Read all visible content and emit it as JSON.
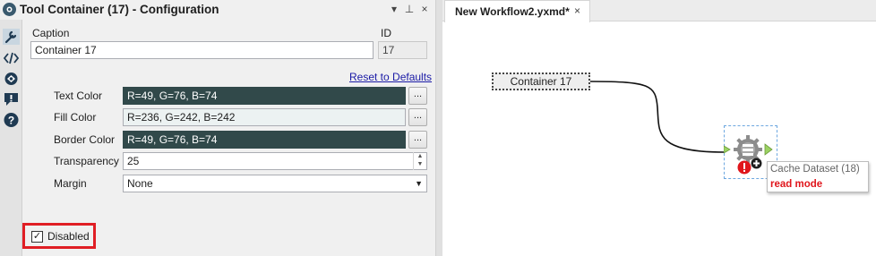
{
  "config_panel": {
    "title": "Tool Container (17) - Configuration",
    "caption_label": "Caption",
    "caption_value": "Container 17",
    "id_label": "ID",
    "id_value": "17",
    "reset_link": "Reset to Defaults",
    "text_color_label": "Text Color",
    "text_color_value": "R=49, G=76, B=74",
    "fill_color_label": "Fill Color",
    "fill_color_value": "R=236, G=242, B=242",
    "border_color_label": "Border Color",
    "border_color_value": "R=49, G=76, B=74",
    "transparency_label": "Transparency",
    "transparency_value": "25",
    "margin_label": "Margin",
    "margin_value": "None",
    "browse_button_label": "...",
    "disabled_label": "Disabled",
    "disabled_checked": true
  },
  "rail_icons": [
    "wrench-icon",
    "code-icon",
    "navigate-icon",
    "comment-icon",
    "help-icon"
  ],
  "canvas": {
    "tab_label": "New Workflow2.yxmd*",
    "tab_close": "×",
    "container_label": "Container 17",
    "tooltip_title": "Cache Dataset (18)",
    "tooltip_status": "read mode"
  },
  "colors": {
    "text_color": "#314c4a",
    "fill_color": "#ecf2f2",
    "border_color": "#314c4a",
    "highlight_red": "#e01e24",
    "error_red": "#e0161c",
    "link_blue": "#1a1aa6",
    "anchor_green": "#9bd262"
  }
}
